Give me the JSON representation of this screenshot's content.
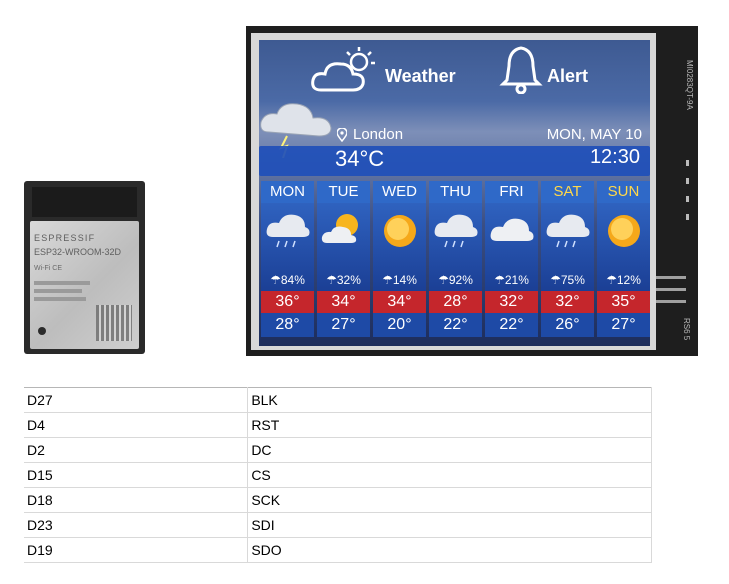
{
  "module": {
    "brand": "ESPRESSIF",
    "model": "ESP32-WROOM-32D",
    "cert": "Wi-Fi  CE"
  },
  "board": {
    "side_label": "MI0283QT-9A",
    "bottom_label": "RS6 5"
  },
  "screen": {
    "header": {
      "weather_label": "Weather",
      "alert_label": "Alert"
    },
    "location": "London",
    "date": "MON, MAY 10",
    "temperature_now": "34°C",
    "time_now": "12:30",
    "forecast": [
      {
        "day": "MON",
        "icon": "storm-cloud-icon",
        "rain": "☂84%",
        "high": "36°",
        "low": "28°"
      },
      {
        "day": "TUE",
        "icon": "partly-sunny-icon",
        "rain": "☂32%",
        "high": "34°",
        "low": "27°"
      },
      {
        "day": "WED",
        "icon": "sun-icon",
        "rain": "☂14%",
        "high": "34°",
        "low": "20°"
      },
      {
        "day": "THU",
        "icon": "storm-cloud-icon",
        "rain": "☂92%",
        "high": "28°",
        "low": "22°"
      },
      {
        "day": "FRI",
        "icon": "cloud-icon",
        "rain": "☂21%",
        "high": "32°",
        "low": "22°"
      },
      {
        "day": "SAT",
        "icon": "storm-cloud-icon",
        "rain": "☂75%",
        "high": "32°",
        "low": "26°"
      },
      {
        "day": "SUN",
        "icon": "sun-icon",
        "rain": "☂12%",
        "high": "35°",
        "low": "27°"
      }
    ],
    "colors": {
      "high_band": "#c5262c",
      "low_band": "#1e4aa6",
      "day_header": "#2f69c8",
      "weekend_text": "#ffd84a"
    }
  },
  "pin_table": {
    "rows": [
      {
        "esp_pin": "D27",
        "tft_pin": "BLK"
      },
      {
        "esp_pin": "D4",
        "tft_pin": "RST"
      },
      {
        "esp_pin": "D2",
        "tft_pin": "DC"
      },
      {
        "esp_pin": "D15",
        "tft_pin": "CS"
      },
      {
        "esp_pin": "D18",
        "tft_pin": "SCK"
      },
      {
        "esp_pin": "D23",
        "tft_pin": "SDI"
      },
      {
        "esp_pin": "D19",
        "tft_pin": "SDO"
      }
    ]
  }
}
